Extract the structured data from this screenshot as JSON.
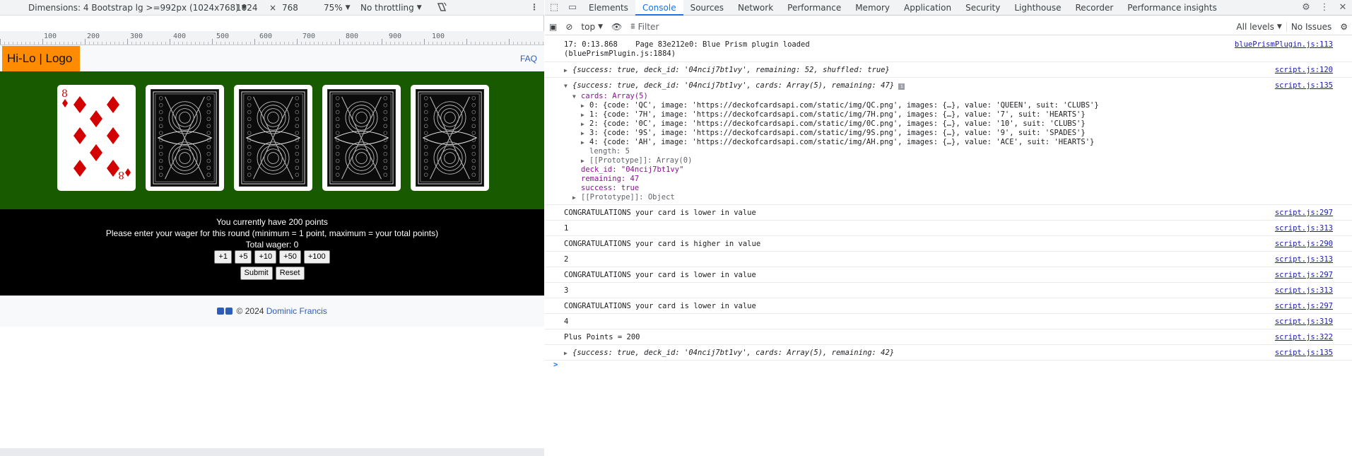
{
  "device_toolbar": {
    "dimensions": "Dimensions: 4 Bootstrap lg >=992px (1024x768)",
    "width": "1024",
    "times": "×",
    "height": "768",
    "zoom": "75%",
    "throttling": "No throttling"
  },
  "ruler": {
    "labels": [
      "100",
      "200",
      "300",
      "400",
      "500",
      "600",
      "700",
      "800",
      "900",
      "100"
    ]
  },
  "site": {
    "logo": "Hi-Lo | Logo",
    "faq": "FAQ",
    "points_line": "You currently have 200 points",
    "wager_prompt": "Please enter your wager for this round (minimum = 1 point, maximum = your total points)",
    "total_wager": "Total wager: 0",
    "wager_buttons": [
      "+1",
      "+5",
      "+10",
      "+50",
      "+100"
    ],
    "submit": "Submit",
    "reset": "Reset",
    "footer_text": "© 2024",
    "footer_link": "Dominic Francis",
    "face_card": {
      "rank": "8",
      "suit": "♦",
      "color": "#d30000"
    }
  },
  "devtools": {
    "tabs": [
      "Elements",
      "Console",
      "Sources",
      "Network",
      "Performance",
      "Memory",
      "Application",
      "Security",
      "Lighthouse",
      "Recorder",
      "Performance insights"
    ],
    "active_tab": "Console",
    "context": "top",
    "filter_placeholder": "Filter",
    "levels": "All levels",
    "issues": "No Issues",
    "log": {
      "r1_text": "17: 0:13.868    Page 83e212e0: Blue Prism plugin loaded",
      "r1_text2": "(bluePrismPlugin.js:1884)",
      "r1_src": "bluePrismPlugin.js:113",
      "r2_text": "{success: true, deck_id: '04ncij7bt1vy', remaining: 52, shuffled: true}",
      "r2_src": "script.js:120",
      "r3_text": "{success: true, deck_id: '04ncij7bt1vy', cards: Array(5), remaining: 47}",
      "r3_src": "script.js:135",
      "r3_cards": "cards: Array(5)",
      "r3_items": [
        "0: {code: 'QC', image: 'https://deckofcardsapi.com/static/img/QC.png', images: {…}, value: 'QUEEN', suit: 'CLUBS'}",
        "1: {code: '7H', image: 'https://deckofcardsapi.com/static/img/7H.png', images: {…}, value: '7', suit: 'HEARTS'}",
        "2: {code: '0C', image: 'https://deckofcardsapi.com/static/img/0C.png', images: {…}, value: '10', suit: 'CLUBS'}",
        "3: {code: '9S', image: 'https://deckofcardsapi.com/static/img/9S.png', images: {…}, value: '9', suit: 'SPADES'}",
        "4: {code: 'AH', image: 'https://deckofcardsapi.com/static/img/AH.png', images: {…}, value: 'ACE', suit: 'HEARTS'}"
      ],
      "r3_length": "length: 5",
      "r3_proto_arr": "[[Prototype]]: Array(0)",
      "r3_deck": "deck_id: \"04ncij7bt1vy\"",
      "r3_remaining": "remaining: 47",
      "r3_success": "success: true",
      "r3_proto_obj": "[[Prototype]]: Object",
      "rows": [
        {
          "text": "CONGRATULATIONS your card is lower in value",
          "src": "script.js:297"
        },
        {
          "text": "1",
          "src": "script.js:313"
        },
        {
          "text": "CONGRATULATIONS your card is higher in value",
          "src": "script.js:290"
        },
        {
          "text": "2",
          "src": "script.js:313"
        },
        {
          "text": "CONGRATULATIONS your card is lower in value",
          "src": "script.js:297"
        },
        {
          "text": "3",
          "src": "script.js:313"
        },
        {
          "text": "CONGRATULATIONS your card is lower in value",
          "src": "script.js:297"
        },
        {
          "text": "4",
          "src": "script.js:319"
        },
        {
          "text": "Plus Points = 200",
          "src": "script.js:322"
        }
      ],
      "r_last_text": "{success: true, deck_id: '04ncij7bt1vy', cards: Array(5), remaining: 42}",
      "r_last_src": "script.js:135",
      "prompt": ">"
    }
  }
}
